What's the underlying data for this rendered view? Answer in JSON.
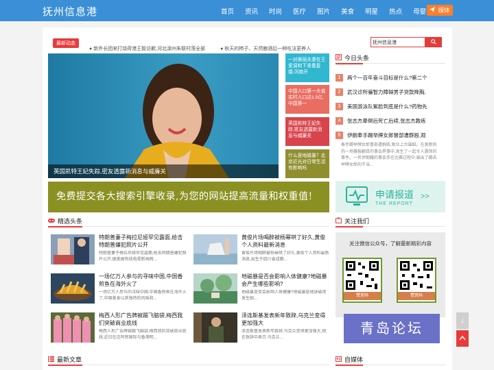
{
  "site": {
    "logo": "抚州信息港"
  },
  "nav": {
    "items": [
      "首页",
      "资讯",
      "时尚",
      "医疗",
      "图片",
      "美食",
      "明星",
      "热点",
      "母婴"
    ],
    "media_label": "媒体"
  },
  "ticker": {
    "tag": "最新动态",
    "items": [
      "新外长团来打烧荷港王毅访歉,河北滦州朱联村落全部",
      "秋天的柿子、天然酿酒后一种吃法更养人"
    ]
  },
  "search": {
    "value": "抚州信息港"
  },
  "hero": {
    "caption": "英国凯特王妃失踪,密友透露新消息与威廉关",
    "side_items": [
      {
        "text": "一对美丽夫妻在王爱调和下准备复婚,河南开",
        "color": "#31b7cf"
      },
      {
        "text": "中国人口第一大省实时人口达1.5亿,中国第一",
        "color": "#ea6d61"
      },
      {
        "text": "英国凯特王妃失踪,密友透露新消息与威廉关",
        "color": "#d8444c"
      },
      {
        "text": "什么是地磁暴？北京近光对日常生活有影响吗",
        "color": "#8f8f30"
      }
    ]
  },
  "banner": {
    "text": "免费提交各大搜索引擎收录,为您的网站提高流量和权重值!"
  },
  "featured": {
    "title": "精选头条",
    "cards": [
      {
        "title": "特朗普妻子梅拉尼娅罕见露面,给击特朗普嫌犯照片公开",
        "desc": "特朗普妻子梅拉尼娅罕见露面,枪击特朗普嫌犯照片公开,据美国有线电视新闻网..."
      },
      {
        "title": "黄俊片场喝醉被杨幂哄了好久,黄俊个人资料最新消息",
        "desc": "黄俊片场喝醉被杨幂哄了好久,黄俊个人资料最新消息,出生于四川省成都..."
      },
      {
        "title": "一场亿万人参与的寻味中国,中国香煎鱼在海外火了",
        "desc": "一场亿万人参与的寻味中国,中国香煎鱼在海外火了,中国美食以其独特的风味和..."
      },
      {
        "title": "地磁暴是否会影响人体健康?地磁暴会产生哪些影响?",
        "desc": "地磁暴是否会影响人体健康?地磁暴是地球磁场发生剧..."
      },
      {
        "title": "梅西人形广告牌被踢飞脑袋,梅西我们突破商业底线",
        "desc": "梅西人形广告牌被踢飞脑袋,梅西我的突破商业底线,近日在迈阿密国际与香港明..."
      },
      {
        "title": "泽连斯基发表新年致辞,乌克兰变得更加强大",
        "desc": "泽连斯基发表新年致辞,乌克兰变得更加强大,他在致辞中表示,乌克兰..."
      }
    ]
  },
  "latest": {
    "title": "最新文章"
  },
  "today": {
    "title": "今日头条",
    "items": [
      "两个一百年奋斗目标是什么?第二个",
      "武汉诊所骗智力障碍男子贷款降胸,",
      "美国游泳队紫脸到底是什么?药物先",
      "张志杰晕倒后死亡后续,张志杰教练",
      "伊朗奉手踢举牌女郎督部遭群殴,观"
    ],
    "desc": "奉手踢举牌女郎督部遭群殴,观众上台围殴。在美新利的一场赛报翻目的事会界事中,发生了一起令人震惊的事件。一名伊朗籍的事会手在比赛过程中,被出了踢击举牌女郎的不当..."
  },
  "report": {
    "title": "申请报道",
    "subtitle": "THE REPORT",
    "arrows": ">>"
  },
  "follow": {
    "title": "关注我们",
    "desc": "关注微信公众号，了解最新精彩内容",
    "qr_label": "赞赏码"
  },
  "qingdao": {
    "text": "青岛论坛"
  },
  "media": {
    "title": "自媒体"
  },
  "float": {
    "gray_label": "⊥"
  }
}
